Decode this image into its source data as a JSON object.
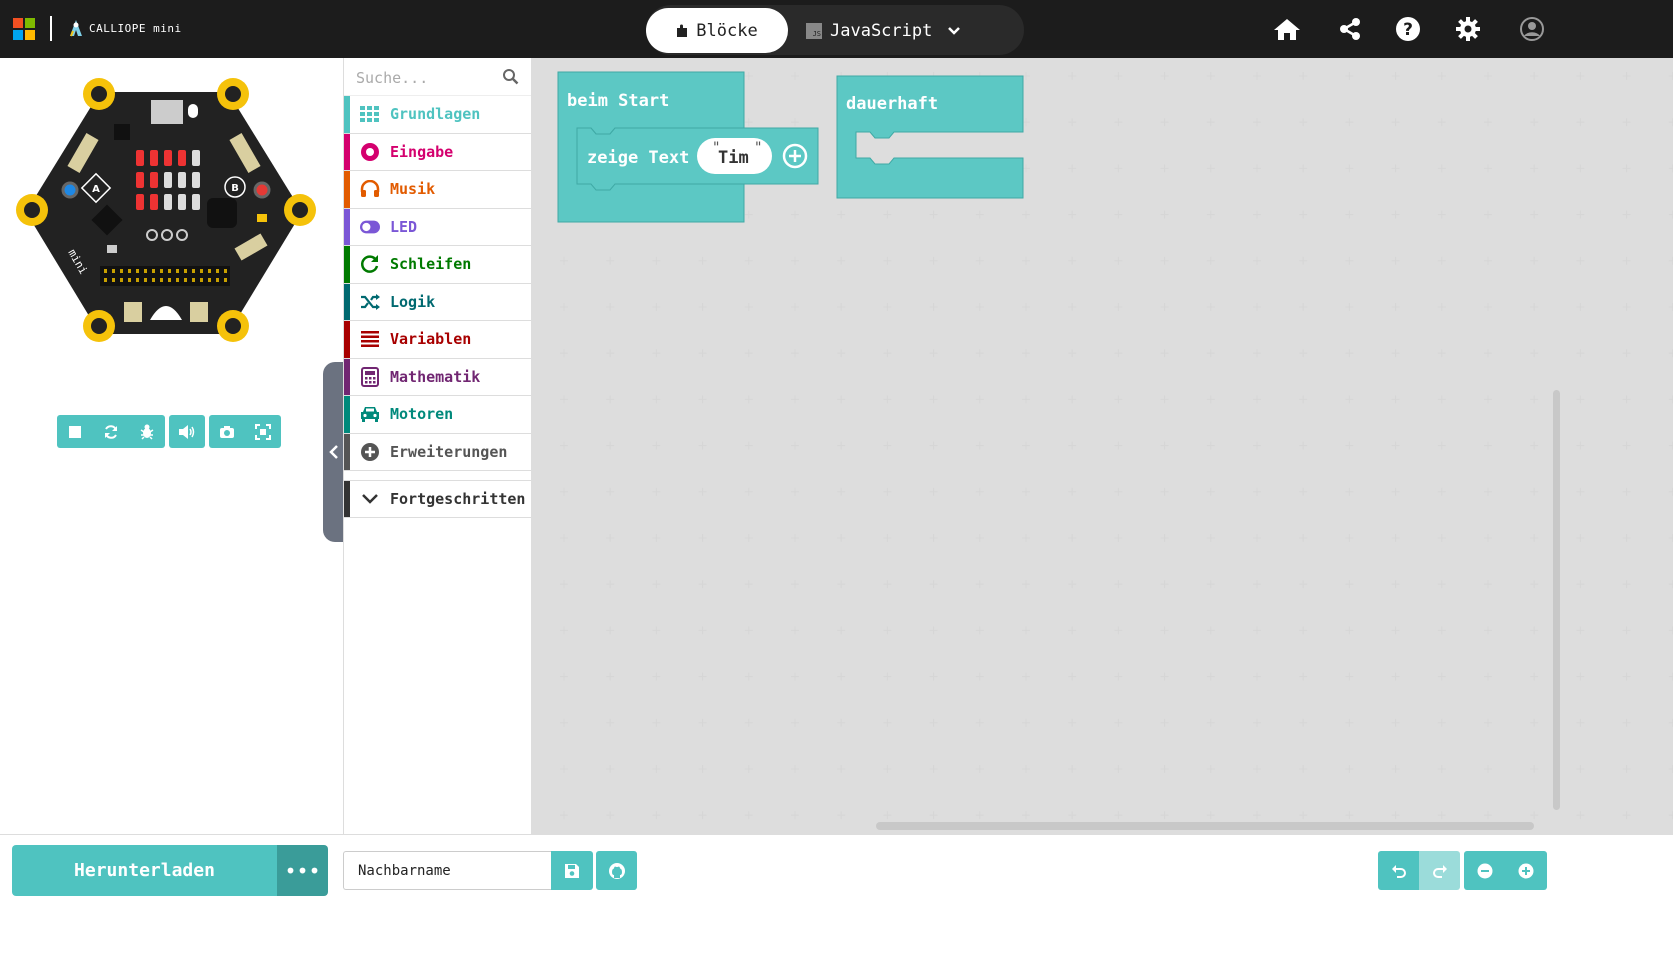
{
  "colors": {
    "header_bg": "#1c1c1c",
    "accent": "#4fc3c0",
    "ms_logo": [
      "#f25022",
      "#7fba00",
      "#00a4ef",
      "#ffb900"
    ]
  },
  "header": {
    "brand": "CALLIOPE mini",
    "mode_blocks_label": "Blöcke",
    "mode_js_label": "JavaScript",
    "icons": [
      "home-icon",
      "share-icon",
      "help-icon",
      "settings-icon",
      "user-icon"
    ]
  },
  "simulator": {
    "button_a": "A",
    "button_b": "B",
    "controls": [
      "stop-icon",
      "restart-icon",
      "debug-icon",
      "mute-icon",
      "screenshot-icon",
      "fullscreen-icon"
    ]
  },
  "toolbox": {
    "search_placeholder": "Suche...",
    "categories": [
      {
        "label": "Grundlagen",
        "color": "#4fc3c0",
        "icon": "grid-icon"
      },
      {
        "label": "Eingabe",
        "color": "#d4006e",
        "icon": "input-icon"
      },
      {
        "label": "Musik",
        "color": "#e25b00",
        "icon": "headphones-icon"
      },
      {
        "label": "LED",
        "color": "#7b57d6",
        "icon": "toggle-icon"
      },
      {
        "label": "Schleifen",
        "color": "#007a00",
        "icon": "loop-icon"
      },
      {
        "label": "Logik",
        "color": "#006970",
        "icon": "shuffle-icon"
      },
      {
        "label": "Variablen",
        "color": "#a80000",
        "icon": "list-icon"
      },
      {
        "label": "Mathematik",
        "color": "#712672",
        "icon": "calculator-icon"
      },
      {
        "label": "Motoren",
        "color": "#00897b",
        "icon": "car-icon"
      },
      {
        "label": "Erweiterungen",
        "color": "#555555",
        "icon": "plus-circle-icon"
      }
    ],
    "advanced_label": "Fortgeschritten"
  },
  "workspace": {
    "on_start_label": "beim Start",
    "show_text_label": "zeige Text",
    "text_value": "Tim",
    "forever_label": "dauerhaft"
  },
  "footer": {
    "download_label": "Herunterladen",
    "more_label": "•••",
    "project_name": "Nachbarname"
  }
}
